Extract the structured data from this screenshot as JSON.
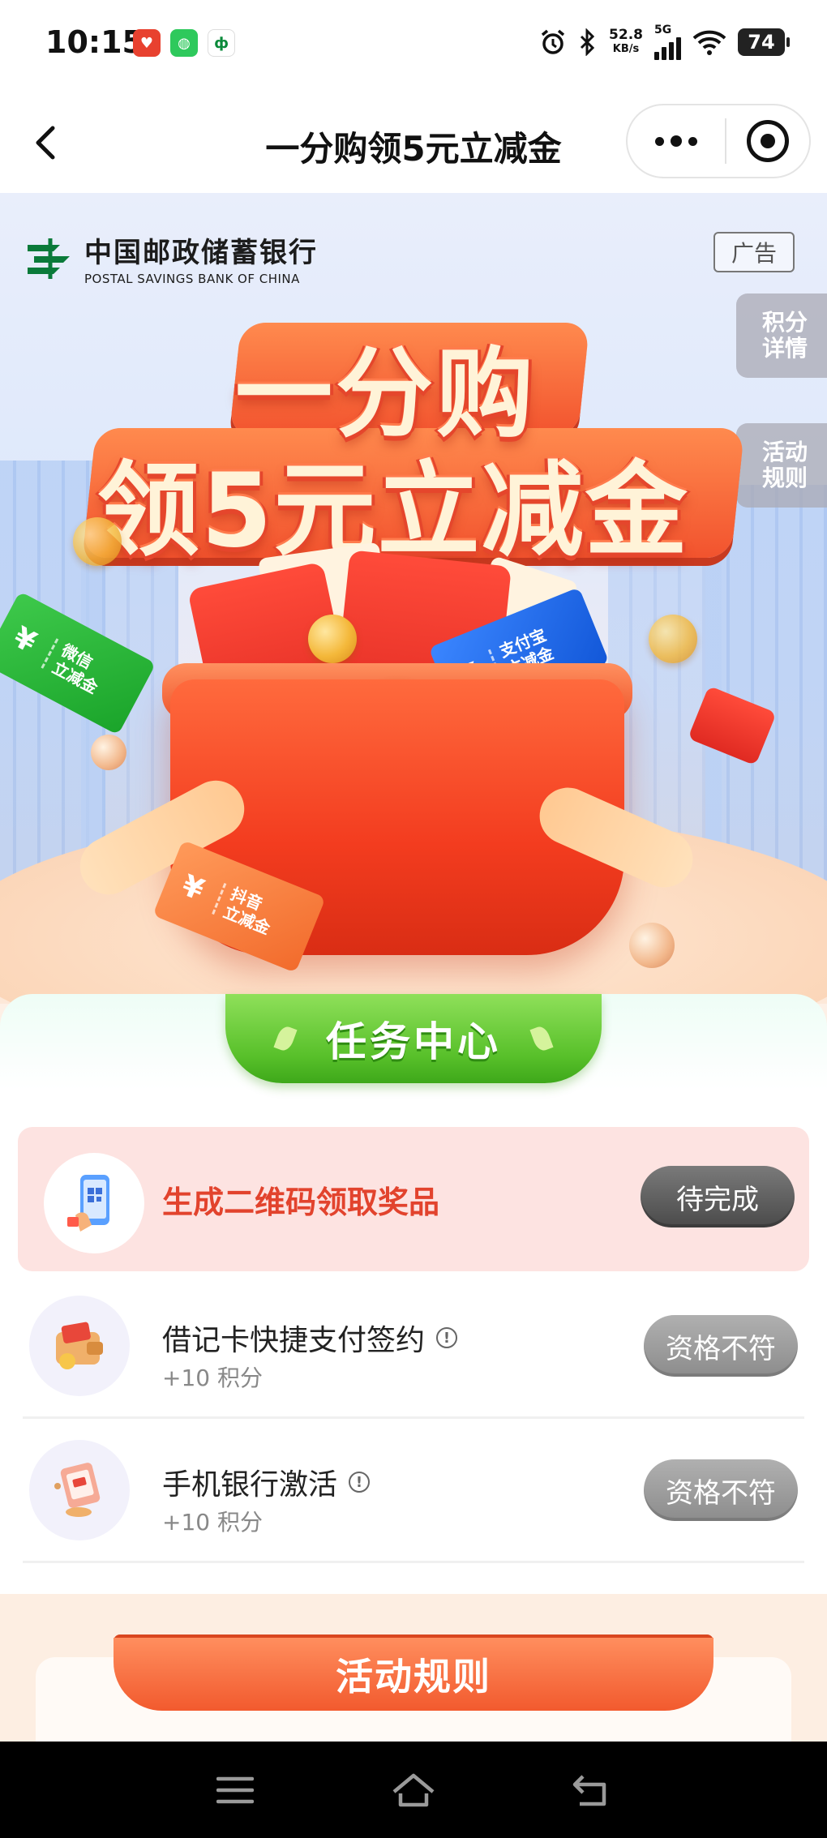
{
  "status_bar": {
    "time": "10:15",
    "net_speed_value": "52.8",
    "net_speed_unit": "KB/s",
    "network_type": "5G",
    "battery": "74",
    "app_icons": [
      "pinduoduo-icon",
      "wechat-icon",
      "bank-app-icon"
    ]
  },
  "nav": {
    "title": "一分购领5元立减金"
  },
  "hero": {
    "bank_name_cn": "中国邮政储蓄银行",
    "bank_name_en": "POSTAL SAVINGS BANK OF CHINA",
    "ad_label": "广告",
    "points_tab": "积分\n详情",
    "points_tab_line1": "积分",
    "points_tab_line2": "详情",
    "rules_tab_line1": "活动",
    "rules_tab_line2": "规则",
    "headline_1": "一分购",
    "headline_2": "领5元立减金",
    "ticket_wechat": [
      "微信",
      "立减金"
    ],
    "ticket_alipay": [
      "支付宝",
      "立减金"
    ],
    "ticket_douyin": [
      "抖音",
      "立减金"
    ],
    "yen_symbol": "¥"
  },
  "tasks": {
    "header": "任务中心",
    "highlighted": {
      "name": "生成二维码领取奖品",
      "button": "待完成"
    },
    "items": [
      {
        "name": "借记卡快捷支付签约",
        "points": "+10 积分",
        "button": "资格不符"
      },
      {
        "name": "手机银行激活",
        "points": "+10 积分",
        "button": "资格不符"
      }
    ]
  },
  "rules": {
    "title": "活动规则"
  },
  "colors": {
    "accent_red": "#e2432d",
    "task_green": "#58c02a",
    "highlight_bg": "#fde3e1"
  }
}
